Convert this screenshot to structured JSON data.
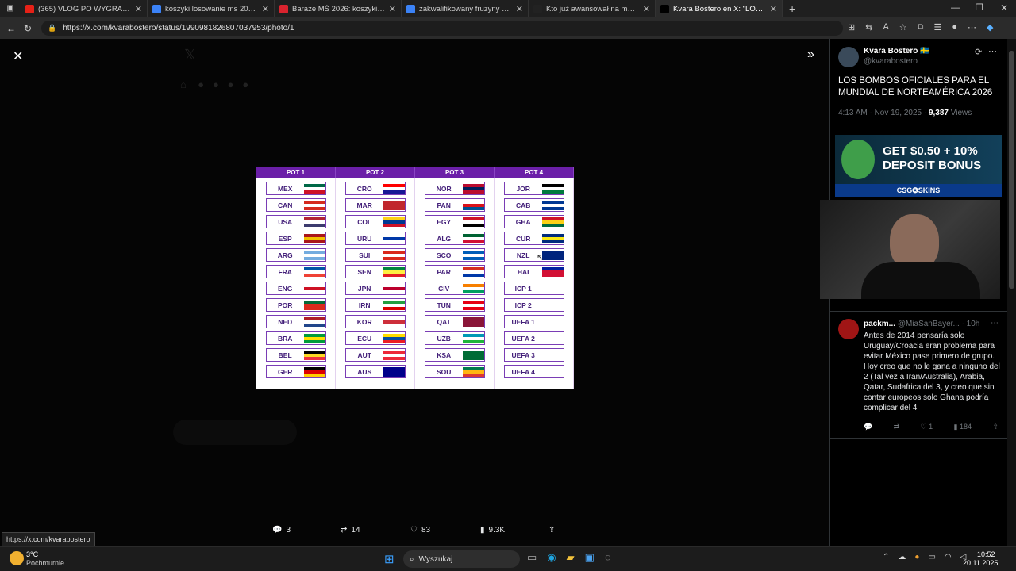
{
  "browser": {
    "tabs": [
      {
        "title": "(365) VLOG PO WYGRANYM MECZU",
        "favicon": "youtube-icon",
        "color": "#e62117"
      },
      {
        "title": "koszyki losowanie ms 2026 - Wys",
        "favicon": "search-icon",
        "color": "#3b82f6"
      },
      {
        "title": "Baraże MŚ 2026: koszyki. Podział",
        "favicon": "news-icon",
        "color": "#d9232e"
      },
      {
        "title": "zakwalifikowany fruzyny na mund",
        "favicon": "search-icon",
        "color": "#3b82f6"
      },
      {
        "title": "Kto już awansował na mundial 20",
        "favicon": "news-icon",
        "color": "#222222"
      },
      {
        "title": "Kvara Bostero en X: \"LOS BOMB",
        "favicon": "x-icon",
        "color": "#000000"
      }
    ],
    "url": "https://x.com/kvarabostero/status/1990981826807037953/photo/1"
  },
  "image": {
    "pot_headers": [
      "POT 1",
      "POT 2",
      "POT 3",
      "POT 4"
    ],
    "pots": [
      [
        "MEX",
        "CAN",
        "USA",
        "ESP",
        "ARG",
        "FRA",
        "ENG",
        "POR",
        "NED",
        "BRA",
        "BEL",
        "GER"
      ],
      [
        "CRO",
        "MAR",
        "COL",
        "URU",
        "SUI",
        "SEN",
        "JPN",
        "IRN",
        "KOR",
        "ECU",
        "AUT",
        "AUS"
      ],
      [
        "NOR",
        "PAN",
        "EGY",
        "ALG",
        "SCO",
        "PAR",
        "CIV",
        "TUN",
        "QAT",
        "UZB",
        "KSA",
        "SOU"
      ],
      [
        "JOR",
        "CAB",
        "GHA",
        "CUR",
        "NZL",
        "HAI",
        "ICP 1",
        "ICP 2",
        "UEFA 1",
        "UEFA 2",
        "UEFA 3",
        "UEFA 4"
      ]
    ],
    "flags": [
      [
        [
          "#006847",
          "#fff",
          "#ce1126"
        ],
        [
          "#d52b1e",
          "#fff",
          "#d52b1e"
        ],
        [
          "#b22234",
          "#fff",
          "#3c3b6e"
        ],
        [
          "#aa151b",
          "#f1bf00",
          "#aa151b"
        ],
        [
          "#74acdf",
          "#fff",
          "#74acdf"
        ],
        [
          "#0055a4",
          "#fff",
          "#ef4135"
        ],
        [
          "#fff",
          "#ce1124",
          "#fff"
        ],
        [
          "#046a38",
          "#da291c",
          "#da291c"
        ],
        [
          "#ae1c28",
          "#fff",
          "#21468b"
        ],
        [
          "#009c3b",
          "#ffdf00",
          "#009c3b"
        ],
        [
          "#000",
          "#fdda24",
          "#ef3340"
        ],
        [
          "#000",
          "#dd0000",
          "#ffce00"
        ]
      ],
      [
        [
          "#ff0000",
          "#fff",
          "#171796"
        ],
        [
          "#c1272d",
          "#c1272d",
          "#c1272d"
        ],
        [
          "#fcd116",
          "#003893",
          "#ce1126"
        ],
        [
          "#fff",
          "#0038a8",
          "#fff"
        ],
        [
          "#da291c",
          "#fff",
          "#da291c"
        ],
        [
          "#00853f",
          "#fdef42",
          "#e31b23"
        ],
        [
          "#fff",
          "#bc002d",
          "#fff"
        ],
        [
          "#239f40",
          "#fff",
          "#da0000"
        ],
        [
          "#fff",
          "#cd2e3a",
          "#fff"
        ],
        [
          "#ffdd00",
          "#034ea2",
          "#ed1c24"
        ],
        [
          "#ed2939",
          "#fff",
          "#ed2939"
        ],
        [
          "#00008b",
          "#00008b",
          "#00008b"
        ]
      ],
      [
        [
          "#ba0c2f",
          "#00205b",
          "#ba0c2f"
        ],
        [
          "#fff",
          "#da121a",
          "#005293"
        ],
        [
          "#ce1126",
          "#fff",
          "#000"
        ],
        [
          "#006233",
          "#fff",
          "#d21034"
        ],
        [
          "#005eb8",
          "#fff",
          "#005eb8"
        ],
        [
          "#d52b1e",
          "#fff",
          "#0038a8"
        ],
        [
          "#f77f00",
          "#fff",
          "#009e60"
        ],
        [
          "#e70013",
          "#fff",
          "#e70013"
        ],
        [
          "#8a1538",
          "#8a1538",
          "#8a1538"
        ],
        [
          "#0099b5",
          "#fff",
          "#1eb53a"
        ],
        [
          "#006c35",
          "#006c35",
          "#006c35"
        ],
        [
          "#007a4d",
          "#ffb612",
          "#de3831"
        ]
      ],
      [
        [
          "#000",
          "#fff",
          "#007a3d"
        ],
        [
          "#003893",
          "#fff",
          "#003893"
        ],
        [
          "#ce1126",
          "#fcd116",
          "#006b3f"
        ],
        [
          "#002b7f",
          "#f9e814",
          "#002b7f"
        ],
        [
          "#00247d",
          "#00247d",
          "#00247d"
        ],
        [
          "#00209f",
          "#d21034",
          "#d21034"
        ],
        [
          "#fff",
          "#fff",
          "#fff"
        ],
        [
          "#fff",
          "#fff",
          "#fff"
        ],
        [
          "#fff",
          "#fff",
          "#fff"
        ],
        [
          "#fff",
          "#fff",
          "#fff"
        ],
        [
          "#fff",
          "#fff",
          "#fff"
        ],
        [
          "#fff",
          "#fff",
          "#fff"
        ]
      ]
    ]
  },
  "tweet": {
    "author": "Kvara Bostero",
    "flag": "🇸🇪",
    "handle": "@kvarabostero",
    "text": "LOS BOMBOS OFICIALES PARA EL MUNDIAL DE NORTEAMÉRICA 2026",
    "time": "4:13 AM · Nov 19, 2025 · ",
    "views_count": "9,387",
    "views_label": " Views",
    "replies": "3",
    "retweets": "14",
    "likes": "83",
    "views_short": "9.3K"
  },
  "ad": {
    "line1": "GET $0.50 + 10%",
    "line2": "DEPOSIT BONUS",
    "brand": "CSG✪SKINS"
  },
  "reply": {
    "author": "packm...",
    "handle": "@MiaSanBayer...",
    "age": "· 10h",
    "text": "Antes de 2014 pensaría solo Uruguay/Croacia eran problema para evitar México pase primero de grupo. Hoy creo que no le gana a ninguno del 2 (Tal vez a Iran/Australia), Arabia, Qatar, Sudafrica del 3, y creo que sin contar europeos solo Ghana podría complicar del 4",
    "likes": "1",
    "views": "184"
  },
  "status_url": "https://x.com/kvarabostero",
  "taskbar": {
    "weather_temp": "3°C",
    "weather_desc": "Pochmurnie",
    "search": "Wyszukaj",
    "time": "10:52",
    "date": "20.11.2025"
  }
}
